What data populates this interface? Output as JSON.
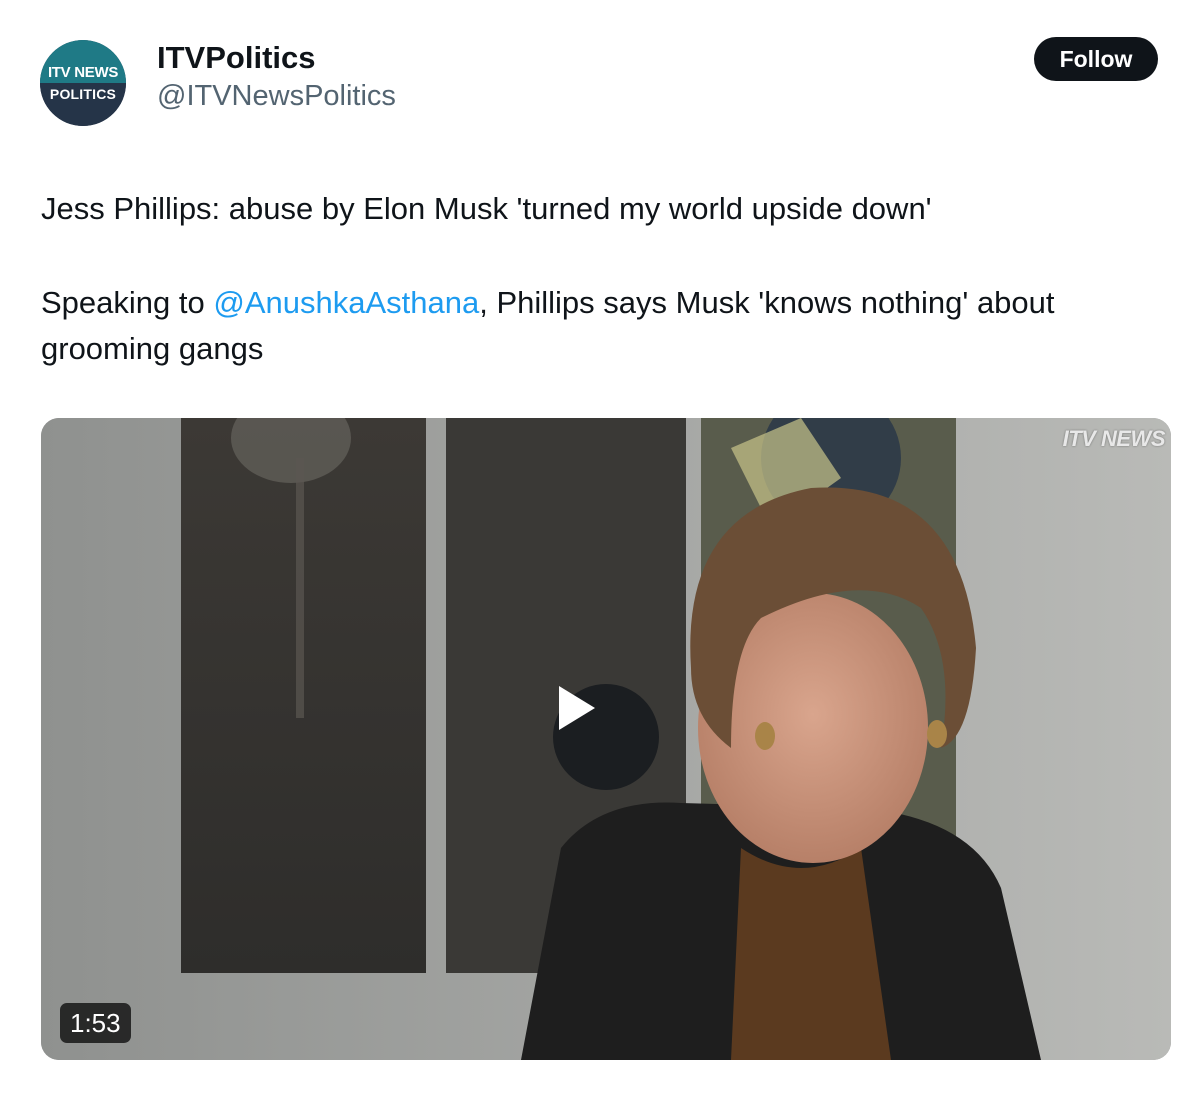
{
  "account": {
    "avatar_line1": "ITV NEWS",
    "avatar_line2": "POLITICS",
    "display_name": "ITVPolitics",
    "handle": "@ITVNewsPolitics"
  },
  "follow_label": "Follow",
  "tweet": {
    "line1": "Jess Phillips: abuse by Elon Musk 'turned my world upside down'",
    "line2_prefix": "Speaking to ",
    "mention": "@AnushkaAsthana",
    "line2_suffix": ", Phillips says Musk 'knows nothing' about grooming gangs"
  },
  "video": {
    "watermark": "ITV NEWS",
    "duration": "1:53"
  },
  "icons": {
    "play": "play-icon",
    "avatar": "itv-news-politics-logo"
  },
  "colors": {
    "link": "#1d9bf0",
    "follow_bg": "#0f1419",
    "muted": "#536471"
  }
}
